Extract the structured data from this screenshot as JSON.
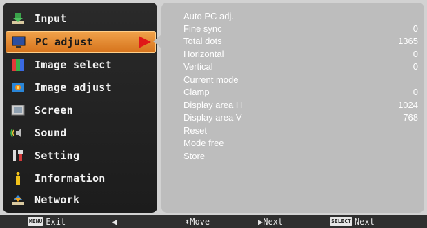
{
  "menu": {
    "items": [
      {
        "label": "Input",
        "icon": "input-icon",
        "selected": false
      },
      {
        "label": "PC adjust",
        "icon": "pc-adjust-icon",
        "selected": true
      },
      {
        "label": "Image select",
        "icon": "image-select-icon",
        "selected": false
      },
      {
        "label": "Image adjust",
        "icon": "image-adjust-icon",
        "selected": false
      },
      {
        "label": "Screen",
        "icon": "screen-icon",
        "selected": false
      },
      {
        "label": "Sound",
        "icon": "sound-icon",
        "selected": false
      },
      {
        "label": "Setting",
        "icon": "setting-icon",
        "selected": false
      },
      {
        "label": "Information",
        "icon": "information-icon",
        "selected": false
      },
      {
        "label": "Network",
        "icon": "network-icon",
        "selected": false
      }
    ]
  },
  "submenu": {
    "rows": [
      {
        "label": "Auto PC adj.",
        "value": ""
      },
      {
        "label": "Fine sync",
        "value": "0"
      },
      {
        "label": "Total dots",
        "value": "1365"
      },
      {
        "label": "Horizontal",
        "value": "0"
      },
      {
        "label": "Vertical",
        "value": "0"
      },
      {
        "label": "Current mode",
        "value": ""
      },
      {
        "label": "Clamp",
        "value": "0"
      },
      {
        "label": "Display area H",
        "value": "1024"
      },
      {
        "label": "Display area V",
        "value": "768"
      },
      {
        "label": "Reset",
        "value": ""
      },
      {
        "label": "Mode free",
        "value": ""
      },
      {
        "label": "Store",
        "value": ""
      }
    ]
  },
  "bottom": {
    "exit_key": "MENU",
    "exit_label": "Exit",
    "back_label": "◀-----",
    "move_label": "⬍Move",
    "next_label": "▶Next",
    "select_key": "SELECT",
    "select_label": "Next"
  },
  "colors": {
    "selected_bg": "#e08a32",
    "arrow": "#e01818",
    "menu_bg": "#222222",
    "submenu_bg": "#bdbdbd"
  }
}
